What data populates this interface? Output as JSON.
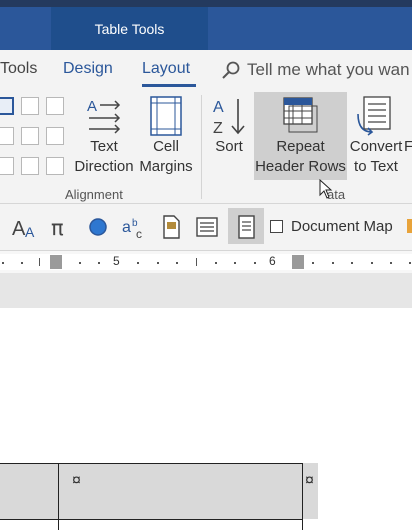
{
  "titlebar": {
    "context_tab": "Table Tools"
  },
  "tabs": [
    {
      "label": "Tools"
    },
    {
      "label": "Design"
    },
    {
      "label": "Layout"
    }
  ],
  "tellme": {
    "text": "Tell me what you wan"
  },
  "ribbon": {
    "text_direction": {
      "line1": "Text",
      "line2": "Direction"
    },
    "cell_margins": {
      "line1": "Cell",
      "line2": "Margins"
    },
    "alignment_group": "Alignment",
    "sort": "Sort",
    "repeat_header_rows": {
      "line1": "Repeat",
      "line2": "Header Rows"
    },
    "convert_to_text": {
      "line1": "Convert",
      "line2": "to Text"
    },
    "partial_f": "F",
    "data_group": "ata"
  },
  "toolbar2": {
    "document_map_label": "Document Map"
  },
  "ruler": {
    "num_5": "5",
    "num_6": "6"
  },
  "table": {
    "cell_mark": "¤"
  },
  "colors": {
    "accent": "#2b579a",
    "titlebar": "#2b579a",
    "ribbon_bg": "#f3f3f3"
  }
}
